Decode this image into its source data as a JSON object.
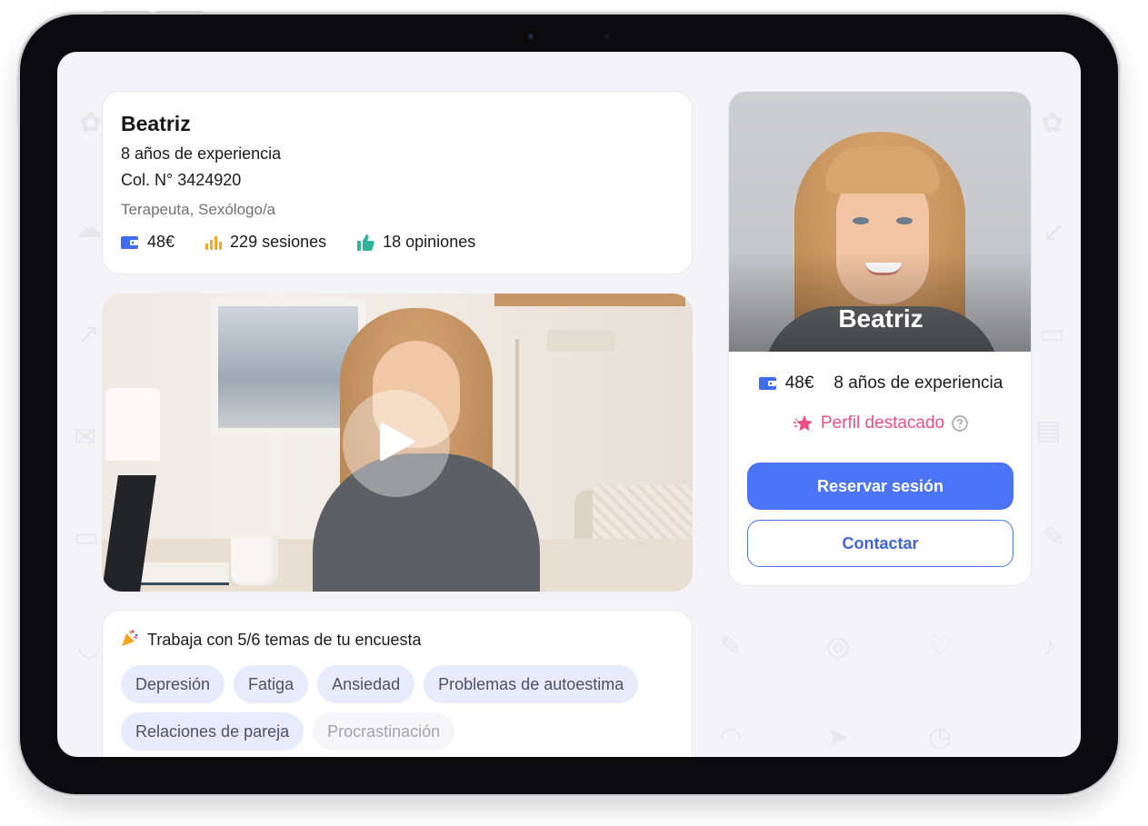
{
  "therapist": {
    "name": "Beatriz",
    "experience": "8 años de experiencia",
    "license": "Col. N° 3424920",
    "role": "Terapeuta, Sexólogo/a"
  },
  "stats": {
    "price": "48€",
    "sessions": "229 sesiones",
    "reviews": "18 opiniones"
  },
  "video": {
    "play_icon": "play-icon"
  },
  "topics": {
    "title": "Trabaja con 5/6 temas de tu encuesta",
    "items": [
      {
        "label": "Depresión",
        "matched": true
      },
      {
        "label": "Fatiga",
        "matched": true
      },
      {
        "label": "Ansiedad",
        "matched": true
      },
      {
        "label": "Problemas de autoestima",
        "matched": true
      },
      {
        "label": "Relaciones de pareja",
        "matched": true
      },
      {
        "label": "Procrastinación",
        "matched": false
      }
    ]
  },
  "profile_card": {
    "photo_name": "Beatriz",
    "price": "48€",
    "experience": "8 años de experiencia",
    "featured": "Perfil destacado",
    "book_button": "Reservar sesión",
    "contact_button": "Contactar"
  },
  "colors": {
    "primary": "#4a74f5",
    "featured": "#ee4f82",
    "chip_bg": "#e7ebfb",
    "wallet": "#3f6df0",
    "bars": "#f5a623",
    "thumb": "#2fb39a"
  }
}
